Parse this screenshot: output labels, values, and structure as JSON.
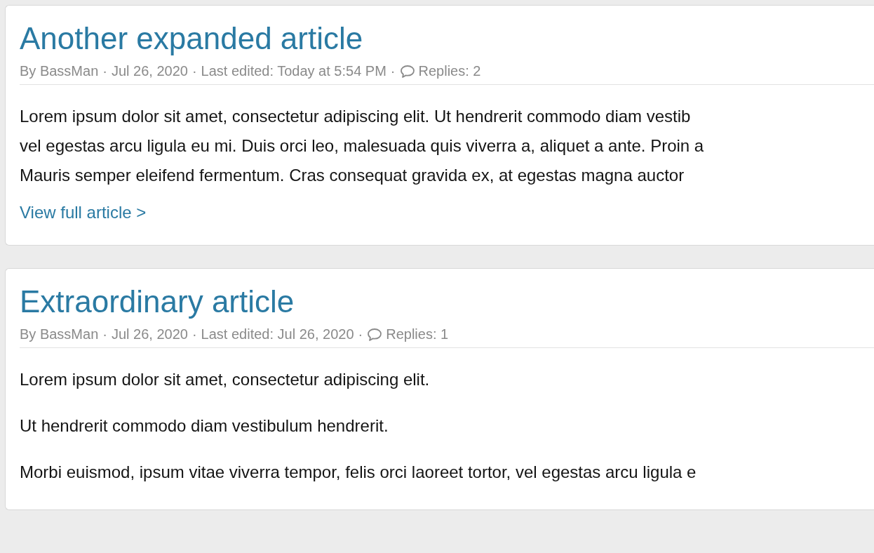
{
  "articles": [
    {
      "title": "Another expanded article",
      "meta": [
        {
          "kind": "text",
          "text": "By BassMan"
        },
        {
          "kind": "sep",
          "text": "·"
        },
        {
          "kind": "text",
          "text": "Jul 26, 2020"
        },
        {
          "kind": "sep",
          "text": "·"
        },
        {
          "kind": "text",
          "text": "Last edited: Today at 5:54 PM"
        },
        {
          "kind": "sep",
          "text": "·"
        },
        {
          "kind": "replies",
          "text": "Replies: 2"
        }
      ],
      "paragraphs": [
        [
          "Lorem ipsum dolor sit amet, consectetur adipiscing elit. Ut hendrerit commodo diam vestib",
          "vel egestas arcu ligula eu mi. Duis orci leo, malesuada quis viverra a, aliquet a ante. Proin a",
          "Mauris semper eleifend fermentum. Cras consequat gravida ex, at egestas magna auctor"
        ]
      ],
      "link": "View full article >"
    },
    {
      "title": "Extraordinary article",
      "meta": [
        {
          "kind": "text",
          "text": "By BassMan"
        },
        {
          "kind": "sep",
          "text": "·"
        },
        {
          "kind": "text",
          "text": "Jul 26, 2020"
        },
        {
          "kind": "sep",
          "text": "·"
        },
        {
          "kind": "text",
          "text": "Last edited: Jul 26, 2020"
        },
        {
          "kind": "sep",
          "text": "·"
        },
        {
          "kind": "replies",
          "text": "Replies: 1"
        }
      ],
      "paragraphs": [
        [
          "Lorem ipsum dolor sit amet, consectetur adipiscing elit."
        ],
        [
          "Ut hendrerit commodo diam vestibulum hendrerit."
        ],
        [
          "Morbi euismod, ipsum vitae viverra tempor, felis orci laoreet tortor, vel egestas arcu ligula e"
        ]
      ]
    }
  ]
}
